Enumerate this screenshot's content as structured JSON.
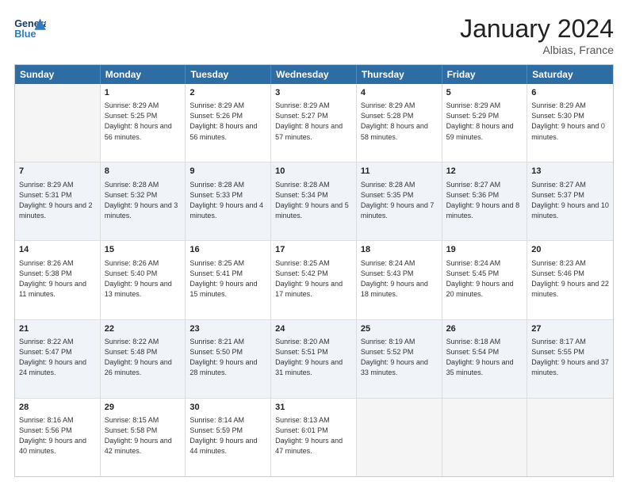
{
  "header": {
    "logo_general": "General",
    "logo_blue": "Blue",
    "month_title": "January 2024",
    "location": "Albias, France"
  },
  "days": [
    "Sunday",
    "Monday",
    "Tuesday",
    "Wednesday",
    "Thursday",
    "Friday",
    "Saturday"
  ],
  "rows": [
    [
      {
        "day": "",
        "sunrise": "",
        "sunset": "",
        "daylight": "",
        "empty": true
      },
      {
        "day": "1",
        "sunrise": "Sunrise: 8:29 AM",
        "sunset": "Sunset: 5:25 PM",
        "daylight": "Daylight: 8 hours and 56 minutes."
      },
      {
        "day": "2",
        "sunrise": "Sunrise: 8:29 AM",
        "sunset": "Sunset: 5:26 PM",
        "daylight": "Daylight: 8 hours and 56 minutes."
      },
      {
        "day": "3",
        "sunrise": "Sunrise: 8:29 AM",
        "sunset": "Sunset: 5:27 PM",
        "daylight": "Daylight: 8 hours and 57 minutes."
      },
      {
        "day": "4",
        "sunrise": "Sunrise: 8:29 AM",
        "sunset": "Sunset: 5:28 PM",
        "daylight": "Daylight: 8 hours and 58 minutes."
      },
      {
        "day": "5",
        "sunrise": "Sunrise: 8:29 AM",
        "sunset": "Sunset: 5:29 PM",
        "daylight": "Daylight: 8 hours and 59 minutes."
      },
      {
        "day": "6",
        "sunrise": "Sunrise: 8:29 AM",
        "sunset": "Sunset: 5:30 PM",
        "daylight": "Daylight: 9 hours and 0 minutes."
      }
    ],
    [
      {
        "day": "7",
        "sunrise": "Sunrise: 8:29 AM",
        "sunset": "Sunset: 5:31 PM",
        "daylight": "Daylight: 9 hours and 2 minutes."
      },
      {
        "day": "8",
        "sunrise": "Sunrise: 8:28 AM",
        "sunset": "Sunset: 5:32 PM",
        "daylight": "Daylight: 9 hours and 3 minutes."
      },
      {
        "day": "9",
        "sunrise": "Sunrise: 8:28 AM",
        "sunset": "Sunset: 5:33 PM",
        "daylight": "Daylight: 9 hours and 4 minutes."
      },
      {
        "day": "10",
        "sunrise": "Sunrise: 8:28 AM",
        "sunset": "Sunset: 5:34 PM",
        "daylight": "Daylight: 9 hours and 5 minutes."
      },
      {
        "day": "11",
        "sunrise": "Sunrise: 8:28 AM",
        "sunset": "Sunset: 5:35 PM",
        "daylight": "Daylight: 9 hours and 7 minutes."
      },
      {
        "day": "12",
        "sunrise": "Sunrise: 8:27 AM",
        "sunset": "Sunset: 5:36 PM",
        "daylight": "Daylight: 9 hours and 8 minutes."
      },
      {
        "day": "13",
        "sunrise": "Sunrise: 8:27 AM",
        "sunset": "Sunset: 5:37 PM",
        "daylight": "Daylight: 9 hours and 10 minutes."
      }
    ],
    [
      {
        "day": "14",
        "sunrise": "Sunrise: 8:26 AM",
        "sunset": "Sunset: 5:38 PM",
        "daylight": "Daylight: 9 hours and 11 minutes."
      },
      {
        "day": "15",
        "sunrise": "Sunrise: 8:26 AM",
        "sunset": "Sunset: 5:40 PM",
        "daylight": "Daylight: 9 hours and 13 minutes."
      },
      {
        "day": "16",
        "sunrise": "Sunrise: 8:25 AM",
        "sunset": "Sunset: 5:41 PM",
        "daylight": "Daylight: 9 hours and 15 minutes."
      },
      {
        "day": "17",
        "sunrise": "Sunrise: 8:25 AM",
        "sunset": "Sunset: 5:42 PM",
        "daylight": "Daylight: 9 hours and 17 minutes."
      },
      {
        "day": "18",
        "sunrise": "Sunrise: 8:24 AM",
        "sunset": "Sunset: 5:43 PM",
        "daylight": "Daylight: 9 hours and 18 minutes."
      },
      {
        "day": "19",
        "sunrise": "Sunrise: 8:24 AM",
        "sunset": "Sunset: 5:45 PM",
        "daylight": "Daylight: 9 hours and 20 minutes."
      },
      {
        "day": "20",
        "sunrise": "Sunrise: 8:23 AM",
        "sunset": "Sunset: 5:46 PM",
        "daylight": "Daylight: 9 hours and 22 minutes."
      }
    ],
    [
      {
        "day": "21",
        "sunrise": "Sunrise: 8:22 AM",
        "sunset": "Sunset: 5:47 PM",
        "daylight": "Daylight: 9 hours and 24 minutes."
      },
      {
        "day": "22",
        "sunrise": "Sunrise: 8:22 AM",
        "sunset": "Sunset: 5:48 PM",
        "daylight": "Daylight: 9 hours and 26 minutes."
      },
      {
        "day": "23",
        "sunrise": "Sunrise: 8:21 AM",
        "sunset": "Sunset: 5:50 PM",
        "daylight": "Daylight: 9 hours and 28 minutes."
      },
      {
        "day": "24",
        "sunrise": "Sunrise: 8:20 AM",
        "sunset": "Sunset: 5:51 PM",
        "daylight": "Daylight: 9 hours and 31 minutes."
      },
      {
        "day": "25",
        "sunrise": "Sunrise: 8:19 AM",
        "sunset": "Sunset: 5:52 PM",
        "daylight": "Daylight: 9 hours and 33 minutes."
      },
      {
        "day": "26",
        "sunrise": "Sunrise: 8:18 AM",
        "sunset": "Sunset: 5:54 PM",
        "daylight": "Daylight: 9 hours and 35 minutes."
      },
      {
        "day": "27",
        "sunrise": "Sunrise: 8:17 AM",
        "sunset": "Sunset: 5:55 PM",
        "daylight": "Daylight: 9 hours and 37 minutes."
      }
    ],
    [
      {
        "day": "28",
        "sunrise": "Sunrise: 8:16 AM",
        "sunset": "Sunset: 5:56 PM",
        "daylight": "Daylight: 9 hours and 40 minutes."
      },
      {
        "day": "29",
        "sunrise": "Sunrise: 8:15 AM",
        "sunset": "Sunset: 5:58 PM",
        "daylight": "Daylight: 9 hours and 42 minutes."
      },
      {
        "day": "30",
        "sunrise": "Sunrise: 8:14 AM",
        "sunset": "Sunset: 5:59 PM",
        "daylight": "Daylight: 9 hours and 44 minutes."
      },
      {
        "day": "31",
        "sunrise": "Sunrise: 8:13 AM",
        "sunset": "Sunset: 6:01 PM",
        "daylight": "Daylight: 9 hours and 47 minutes."
      },
      {
        "day": "",
        "sunrise": "",
        "sunset": "",
        "daylight": "",
        "empty": true
      },
      {
        "day": "",
        "sunrise": "",
        "sunset": "",
        "daylight": "",
        "empty": true
      },
      {
        "day": "",
        "sunrise": "",
        "sunset": "",
        "daylight": "",
        "empty": true
      }
    ]
  ],
  "row_styles": [
    "row-white",
    "row-gray",
    "row-white",
    "row-gray",
    "row-white"
  ]
}
